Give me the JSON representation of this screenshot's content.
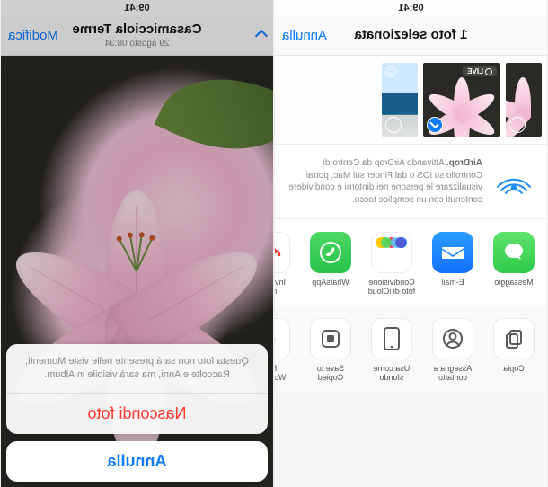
{
  "status_time": "09:41",
  "left": {
    "nav_title": "Casamicciola Terme",
    "nav_subtitle": "29 agosto  08:34",
    "nav_right": "Modifica",
    "sheet_message": "Questa foto non sarà presente nelle viste Momenti, Raccolte e Anni, ma sarà visibile in Album.",
    "hide_label": "Nascondi foto",
    "cancel_label": "Annulla"
  },
  "right": {
    "nav_title": "1 foto selezionata",
    "nav_cancel": "Annulla",
    "live_badge": "LIVE",
    "airdrop_title": "AirDrop.",
    "airdrop_body": "Attivando AirDrop da Centro di Controllo su iOS o dal Finder sul Mac, potrai visualizzare le persone nei dintorni e condividere contenuti con un semplice tocco.",
    "apps": [
      {
        "name": "messaggio",
        "label": "Messaggio",
        "kind": "message"
      },
      {
        "name": "email",
        "label": "E-mail",
        "kind": "mail"
      },
      {
        "name": "icloud-photo-sharing",
        "label": "Condivisione foto di iCloud",
        "kind": "icloud"
      },
      {
        "name": "whatsapp",
        "label": "WhatsApp",
        "kind": "whatsapp"
      },
      {
        "name": "infinit",
        "label": "Invia con Infinit",
        "kind": "infinit"
      }
    ],
    "actions": [
      {
        "name": "copy",
        "label": "Copia",
        "icon": "copy"
      },
      {
        "name": "assign-contact",
        "label": "Assegna a contatto",
        "icon": "contact"
      },
      {
        "name": "wallpaper",
        "label": "Usa come sfondo",
        "icon": "wallpaper"
      },
      {
        "name": "save-copied",
        "label": "Save to Copied",
        "icon": "save"
      },
      {
        "name": "run-workflow",
        "label": "Run Workflow",
        "icon": "workflow"
      }
    ]
  }
}
